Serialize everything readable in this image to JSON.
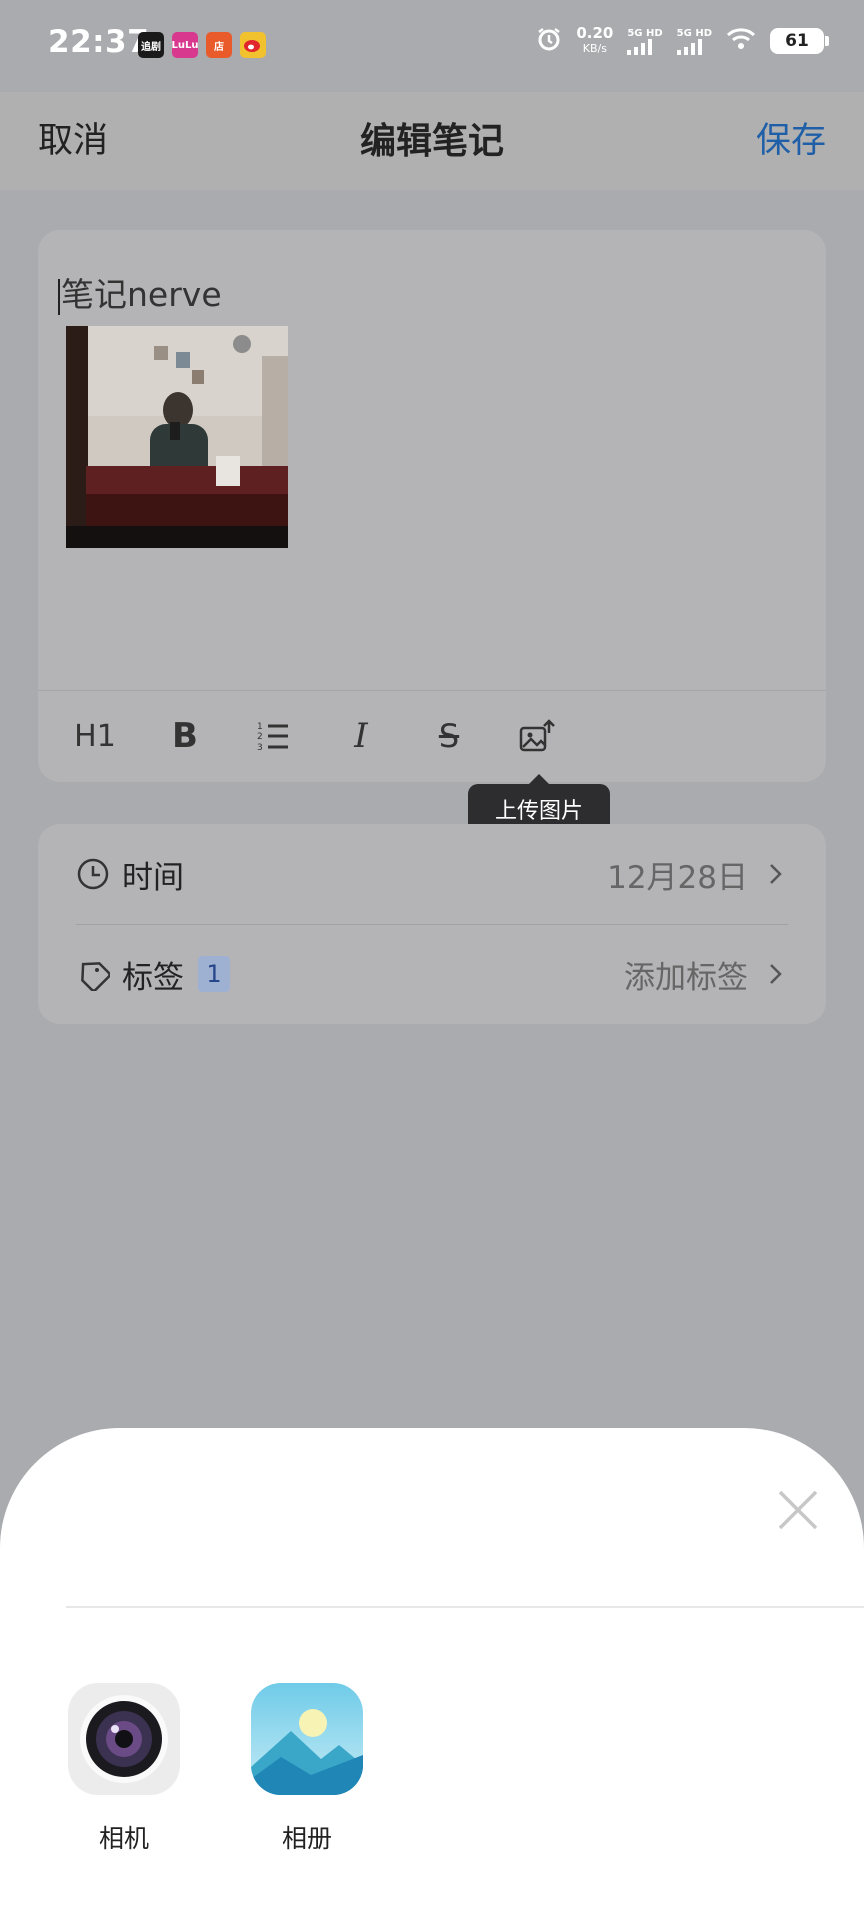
{
  "status_bar": {
    "time": "22:37",
    "net_speed": "0.20",
    "net_unit": "KB/s",
    "sim1": "5G HD",
    "sim2": "5G HD",
    "battery": "61",
    "app_icons": [
      {
        "name": "video-app-icon",
        "text": "追剧",
        "color": "#1a1a1a"
      },
      {
        "name": "shopping-app-icon",
        "text": "LuLu",
        "color": "#d8398f"
      },
      {
        "name": "store-app-icon",
        "text": "店",
        "color": "#ea5b2c"
      },
      {
        "name": "weibo-icon",
        "text": "",
        "color": "#f2c12e"
      }
    ]
  },
  "nav": {
    "cancel": "取消",
    "title": "编辑笔记",
    "save": "保存"
  },
  "editor": {
    "text": "笔记nerve",
    "toolbar": {
      "h1": "H1",
      "bold": "B",
      "italic": "I",
      "strike": "S"
    },
    "tooltip": "上传图片"
  },
  "props": {
    "time_label": "时间",
    "time_value": "12月28日",
    "tag_label": "标签",
    "tag_count": "1",
    "tag_value": "添加标签"
  },
  "sheet": {
    "options": [
      {
        "label": "相机"
      },
      {
        "label": "相册"
      }
    ]
  },
  "colors": {
    "accent": "#1f5fa8",
    "overlay": "#a9abae"
  }
}
